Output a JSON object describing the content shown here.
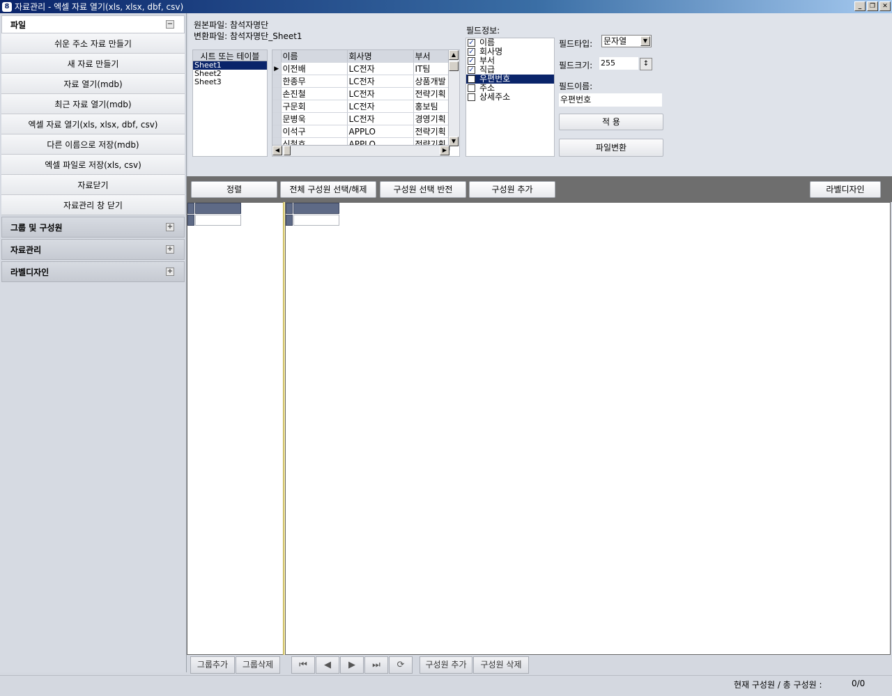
{
  "window": {
    "title": "자료관리 - 엑셀 자료 열기(xls, xlsx, dbf, csv)",
    "icon": "8",
    "controls": [
      "_",
      "❐",
      "✕"
    ]
  },
  "sidebar": {
    "file_section": {
      "label": "파일",
      "toggle": "−",
      "items": [
        "쉬운 주소 자료 만들기",
        "새 자료 만들기",
        "자료 열기(mdb)",
        "최근 자료 열기(mdb)",
        "엑셀 자료 열기(xls, xlsx, dbf, csv)",
        "다른 이름으로 저장(mdb)",
        "엑셀 파일로 저장(xls, csv)",
        "자료닫기",
        "자료관리 창 닫기"
      ]
    },
    "collapsed_sections": [
      {
        "label": "그룹 및 구성원",
        "toggle": "+"
      },
      {
        "label": "자료관리",
        "toggle": "+"
      },
      {
        "label": "라벨디자인",
        "toggle": "+"
      }
    ]
  },
  "source": {
    "original_file": "원본파일: 참석자명단",
    "converted_file": "변환파일: 참석자명단_Sheet1"
  },
  "sheets": {
    "header": "시트 또는 테이블",
    "items": [
      "Sheet1",
      "Sheet2",
      "Sheet3"
    ],
    "selected_index": 0
  },
  "preview_grid": {
    "columns": [
      "이름",
      "회사명",
      "부서"
    ],
    "rows": [
      [
        "이전배",
        "LC전자",
        "IT팀"
      ],
      [
        "한종무",
        "LC전자",
        "상품개발"
      ],
      [
        "손진철",
        "LC전자",
        "전략기획"
      ],
      [
        "구문회",
        "LC전자",
        "홍보팀"
      ],
      [
        "문병욱",
        "LC전자",
        "경영기획"
      ],
      [
        "이석구",
        "APPLO",
        "전략기획"
      ],
      [
        "신철호",
        "APPLO",
        "전략기획"
      ]
    ],
    "current_row": 0
  },
  "field_info": {
    "label": "필드정보:",
    "fields": [
      {
        "name": "이름",
        "checked": true
      },
      {
        "name": "회사명",
        "checked": true
      },
      {
        "name": "부서",
        "checked": true
      },
      {
        "name": "직급",
        "checked": true
      },
      {
        "name": "우편번호",
        "checked": false,
        "selected": true
      },
      {
        "name": "주소",
        "checked": false
      },
      {
        "name": "상세주소",
        "checked": false
      }
    ],
    "type_label": "필드타입:",
    "type_value": "문자열",
    "size_label": "필드크기:",
    "size_value": "255",
    "name_label": "필드이름:",
    "name_value": "우편번호",
    "apply_button": "적  용",
    "convert_button": "파일변환"
  },
  "toolbar": {
    "sort": "정렬",
    "select_all": "전체 구성원 선택/해제",
    "invert_selection": "구성원 선택 반전",
    "add_member": "구성원 추가",
    "label_design": "라벨디자인"
  },
  "bottom": {
    "add_group": "그룹추가",
    "delete_group": "그룹삭제",
    "nav_first": "⏮",
    "nav_prev": "◀",
    "nav_next": "▶",
    "nav_last": "⏭",
    "nav_refresh": "⟳",
    "add_member": "구성원 추가",
    "delete_member": "구성원 삭제"
  },
  "status": {
    "label": "현재 구성원 / 총 구성원 :",
    "value": "0/0"
  },
  "colors": {
    "title_bar": "#0a246a",
    "selection": "#0a246a",
    "toolbar_strip": "#6e6e6e",
    "grid_header": "#5e6a86"
  }
}
